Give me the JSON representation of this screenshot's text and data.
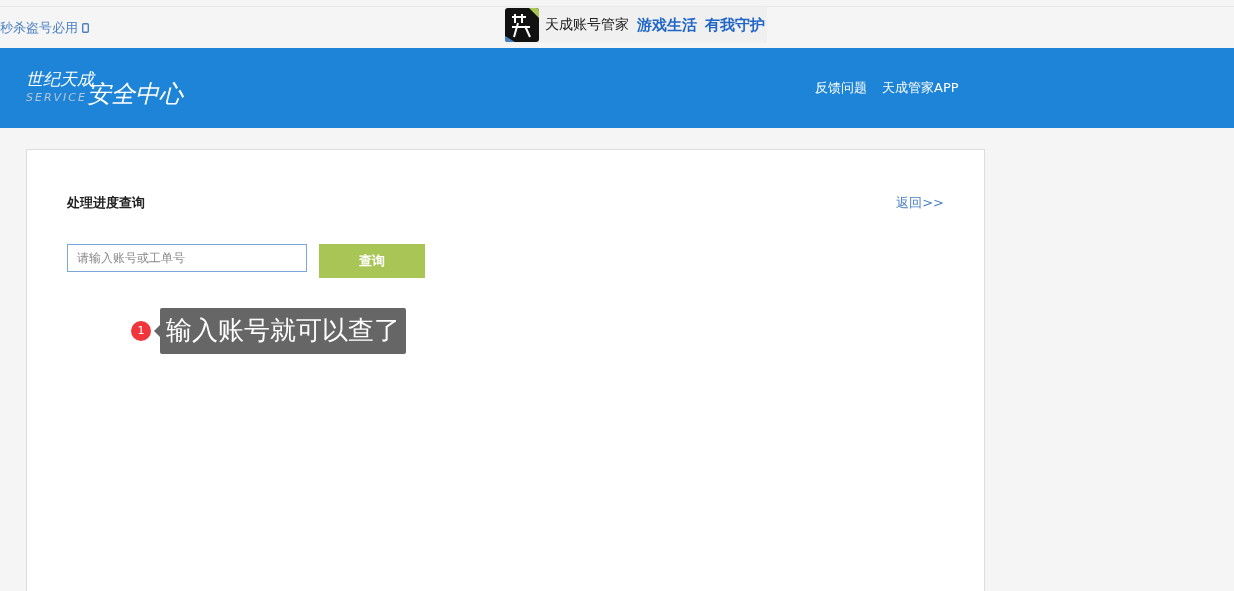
{
  "top_bar": {
    "notice": "秒杀盗号必用",
    "banner": {
      "app_name": "天成账号管家",
      "slogan_1": "游戏生活",
      "slogan_2": "有我守护"
    }
  },
  "header": {
    "logo": {
      "line_1": "世纪天成",
      "service": "SERVICE",
      "line_2": "安全中心"
    },
    "nav": [
      "反馈问题",
      "天成管家APP"
    ]
  },
  "panel": {
    "title": "处理进度查询",
    "back_link": "返回>>",
    "search": {
      "placeholder": "请输入账号或工单号"
    },
    "query_button": "查询"
  },
  "annotation": {
    "number": "1",
    "text": "输入账号就可以查了"
  }
}
